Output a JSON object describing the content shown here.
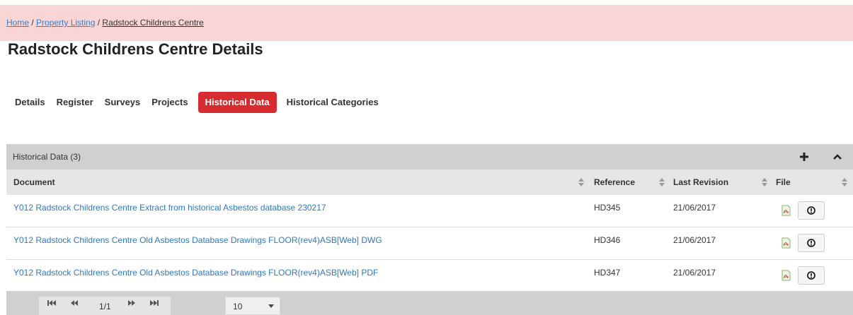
{
  "breadcrumb": {
    "home": "Home",
    "sep1": " / ",
    "listing": "Property Listing",
    "sep2": " / ",
    "current": "Radstock Childrens Centre"
  },
  "page": {
    "title": "Radstock Childrens Centre Details"
  },
  "tabs": [
    {
      "label": "Details",
      "active": false
    },
    {
      "label": "Register",
      "active": false
    },
    {
      "label": "Surveys",
      "active": false
    },
    {
      "label": "Projects",
      "active": false
    },
    {
      "label": "Historical Data",
      "active": true
    },
    {
      "label": "Historical Categories",
      "active": false
    }
  ],
  "panel": {
    "title": "Historical Data (3)",
    "add_icon": "plus-icon",
    "collapse_icon": "chevron-up-icon"
  },
  "table": {
    "columns": [
      "Document",
      "Reference",
      "Last Revision",
      "File"
    ],
    "rows": [
      {
        "document": "Y012 Radstock Childrens Centre Extract from historical Asbestos database 230217",
        "reference": "HD345",
        "last_revision": "21/06/2017",
        "file_icon": "pdf-icon",
        "action_icon": "download-icon"
      },
      {
        "document": "Y012 Radstock Childrens Centre Old Asbestos Database Drawings FLOOR(rev4)ASB[Web] DWG",
        "reference": "HD346",
        "last_revision": "21/06/2017",
        "file_icon": "pdf-icon",
        "action_icon": "download-icon"
      },
      {
        "document": "Y012 Radstock Childrens Centre Old Asbestos Database Drawings FLOOR(rev4)ASB[Web] PDF",
        "reference": "HD347",
        "last_revision": "21/06/2017",
        "file_icon": "pdf-icon",
        "action_icon": "download-icon"
      }
    ]
  },
  "pager": {
    "page_info": "1/1",
    "page_size": "10",
    "first_icon": "first-page-icon",
    "prev_icon": "prev-page-icon",
    "next_icon": "next-page-icon",
    "last_icon": "last-page-icon"
  },
  "colors": {
    "accent": "#d62c2f",
    "breadcrumb_bg": "#f9d6d5",
    "link": "#2f78c0",
    "panel_header": "#d0d0d0"
  }
}
